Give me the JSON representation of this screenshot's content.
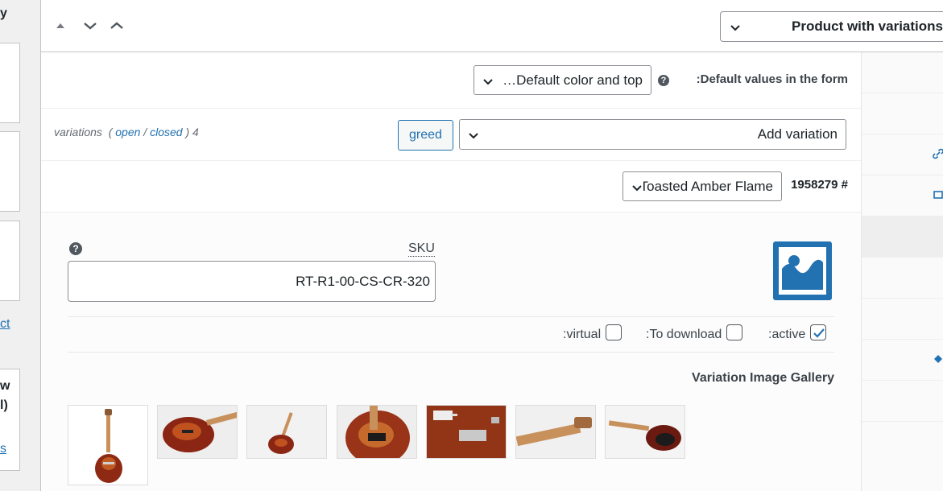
{
  "left_column": {
    "frag_top": "y",
    "link_frag_1": "ct",
    "frag_mid_1": "w",
    "frag_mid_2": "l)",
    "link_frag_2": "s"
  },
  "header": {
    "product_type": "Product with variations",
    "icons": [
      "triangle-up-icon",
      "chevron-down-icon",
      "chevron-up-icon"
    ]
  },
  "defaults": {
    "label": ":Default values in the form",
    "selected": "…Default color and top",
    "help": "?"
  },
  "variations_bar": {
    "prefix": "variations",
    "open": "open",
    "slash": " / ",
    "closed": "closed",
    "count": "4",
    "greed_label": "greed",
    "add_select": "Add variation"
  },
  "variation": {
    "id": "1958279 #",
    "attribute": "Toasted Amber Flame",
    "sku_label": "SKU",
    "sku_value": "RT-R1-00-CS-CR-320",
    "help": "?",
    "options": {
      "virtual": {
        "label": ":virtual",
        "checked": false
      },
      "download": {
        "label": ":To download",
        "checked": false
      },
      "active": {
        "label": ":active",
        "checked": true
      }
    },
    "gallery_title": "Variation Image Gallery",
    "gallery_count": 7
  },
  "colors": {
    "accent": "#2271b1",
    "image_placeholder": "#2271b1",
    "text": "#1d2327"
  }
}
